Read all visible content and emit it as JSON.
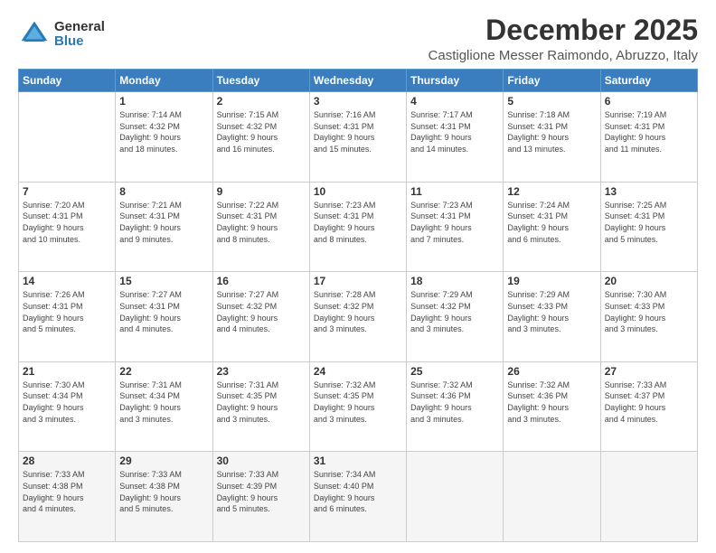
{
  "logo": {
    "general": "General",
    "blue": "Blue"
  },
  "header": {
    "month": "December 2025",
    "location": "Castiglione Messer Raimondo, Abruzzo, Italy"
  },
  "weekdays": [
    "Sunday",
    "Monday",
    "Tuesday",
    "Wednesday",
    "Thursday",
    "Friday",
    "Saturday"
  ],
  "weeks": [
    [
      {
        "day": "",
        "info": ""
      },
      {
        "day": "1",
        "info": "Sunrise: 7:14 AM\nSunset: 4:32 PM\nDaylight: 9 hours\nand 18 minutes."
      },
      {
        "day": "2",
        "info": "Sunrise: 7:15 AM\nSunset: 4:32 PM\nDaylight: 9 hours\nand 16 minutes."
      },
      {
        "day": "3",
        "info": "Sunrise: 7:16 AM\nSunset: 4:31 PM\nDaylight: 9 hours\nand 15 minutes."
      },
      {
        "day": "4",
        "info": "Sunrise: 7:17 AM\nSunset: 4:31 PM\nDaylight: 9 hours\nand 14 minutes."
      },
      {
        "day": "5",
        "info": "Sunrise: 7:18 AM\nSunset: 4:31 PM\nDaylight: 9 hours\nand 13 minutes."
      },
      {
        "day": "6",
        "info": "Sunrise: 7:19 AM\nSunset: 4:31 PM\nDaylight: 9 hours\nand 11 minutes."
      }
    ],
    [
      {
        "day": "7",
        "info": "Sunrise: 7:20 AM\nSunset: 4:31 PM\nDaylight: 9 hours\nand 10 minutes."
      },
      {
        "day": "8",
        "info": "Sunrise: 7:21 AM\nSunset: 4:31 PM\nDaylight: 9 hours\nand 9 minutes."
      },
      {
        "day": "9",
        "info": "Sunrise: 7:22 AM\nSunset: 4:31 PM\nDaylight: 9 hours\nand 8 minutes."
      },
      {
        "day": "10",
        "info": "Sunrise: 7:23 AM\nSunset: 4:31 PM\nDaylight: 9 hours\nand 8 minutes."
      },
      {
        "day": "11",
        "info": "Sunrise: 7:23 AM\nSunset: 4:31 PM\nDaylight: 9 hours\nand 7 minutes."
      },
      {
        "day": "12",
        "info": "Sunrise: 7:24 AM\nSunset: 4:31 PM\nDaylight: 9 hours\nand 6 minutes."
      },
      {
        "day": "13",
        "info": "Sunrise: 7:25 AM\nSunset: 4:31 PM\nDaylight: 9 hours\nand 5 minutes."
      }
    ],
    [
      {
        "day": "14",
        "info": "Sunrise: 7:26 AM\nSunset: 4:31 PM\nDaylight: 9 hours\nand 5 minutes."
      },
      {
        "day": "15",
        "info": "Sunrise: 7:27 AM\nSunset: 4:31 PM\nDaylight: 9 hours\nand 4 minutes."
      },
      {
        "day": "16",
        "info": "Sunrise: 7:27 AM\nSunset: 4:32 PM\nDaylight: 9 hours\nand 4 minutes."
      },
      {
        "day": "17",
        "info": "Sunrise: 7:28 AM\nSunset: 4:32 PM\nDaylight: 9 hours\nand 3 minutes."
      },
      {
        "day": "18",
        "info": "Sunrise: 7:29 AM\nSunset: 4:32 PM\nDaylight: 9 hours\nand 3 minutes."
      },
      {
        "day": "19",
        "info": "Sunrise: 7:29 AM\nSunset: 4:33 PM\nDaylight: 9 hours\nand 3 minutes."
      },
      {
        "day": "20",
        "info": "Sunrise: 7:30 AM\nSunset: 4:33 PM\nDaylight: 9 hours\nand 3 minutes."
      }
    ],
    [
      {
        "day": "21",
        "info": "Sunrise: 7:30 AM\nSunset: 4:34 PM\nDaylight: 9 hours\nand 3 minutes."
      },
      {
        "day": "22",
        "info": "Sunrise: 7:31 AM\nSunset: 4:34 PM\nDaylight: 9 hours\nand 3 minutes."
      },
      {
        "day": "23",
        "info": "Sunrise: 7:31 AM\nSunset: 4:35 PM\nDaylight: 9 hours\nand 3 minutes."
      },
      {
        "day": "24",
        "info": "Sunrise: 7:32 AM\nSunset: 4:35 PM\nDaylight: 9 hours\nand 3 minutes."
      },
      {
        "day": "25",
        "info": "Sunrise: 7:32 AM\nSunset: 4:36 PM\nDaylight: 9 hours\nand 3 minutes."
      },
      {
        "day": "26",
        "info": "Sunrise: 7:32 AM\nSunset: 4:36 PM\nDaylight: 9 hours\nand 3 minutes."
      },
      {
        "day": "27",
        "info": "Sunrise: 7:33 AM\nSunset: 4:37 PM\nDaylight: 9 hours\nand 4 minutes."
      }
    ],
    [
      {
        "day": "28",
        "info": "Sunrise: 7:33 AM\nSunset: 4:38 PM\nDaylight: 9 hours\nand 4 minutes."
      },
      {
        "day": "29",
        "info": "Sunrise: 7:33 AM\nSunset: 4:38 PM\nDaylight: 9 hours\nand 5 minutes."
      },
      {
        "day": "30",
        "info": "Sunrise: 7:33 AM\nSunset: 4:39 PM\nDaylight: 9 hours\nand 5 minutes."
      },
      {
        "day": "31",
        "info": "Sunrise: 7:34 AM\nSunset: 4:40 PM\nDaylight: 9 hours\nand 6 minutes."
      },
      {
        "day": "",
        "info": ""
      },
      {
        "day": "",
        "info": ""
      },
      {
        "day": "",
        "info": ""
      }
    ]
  ]
}
